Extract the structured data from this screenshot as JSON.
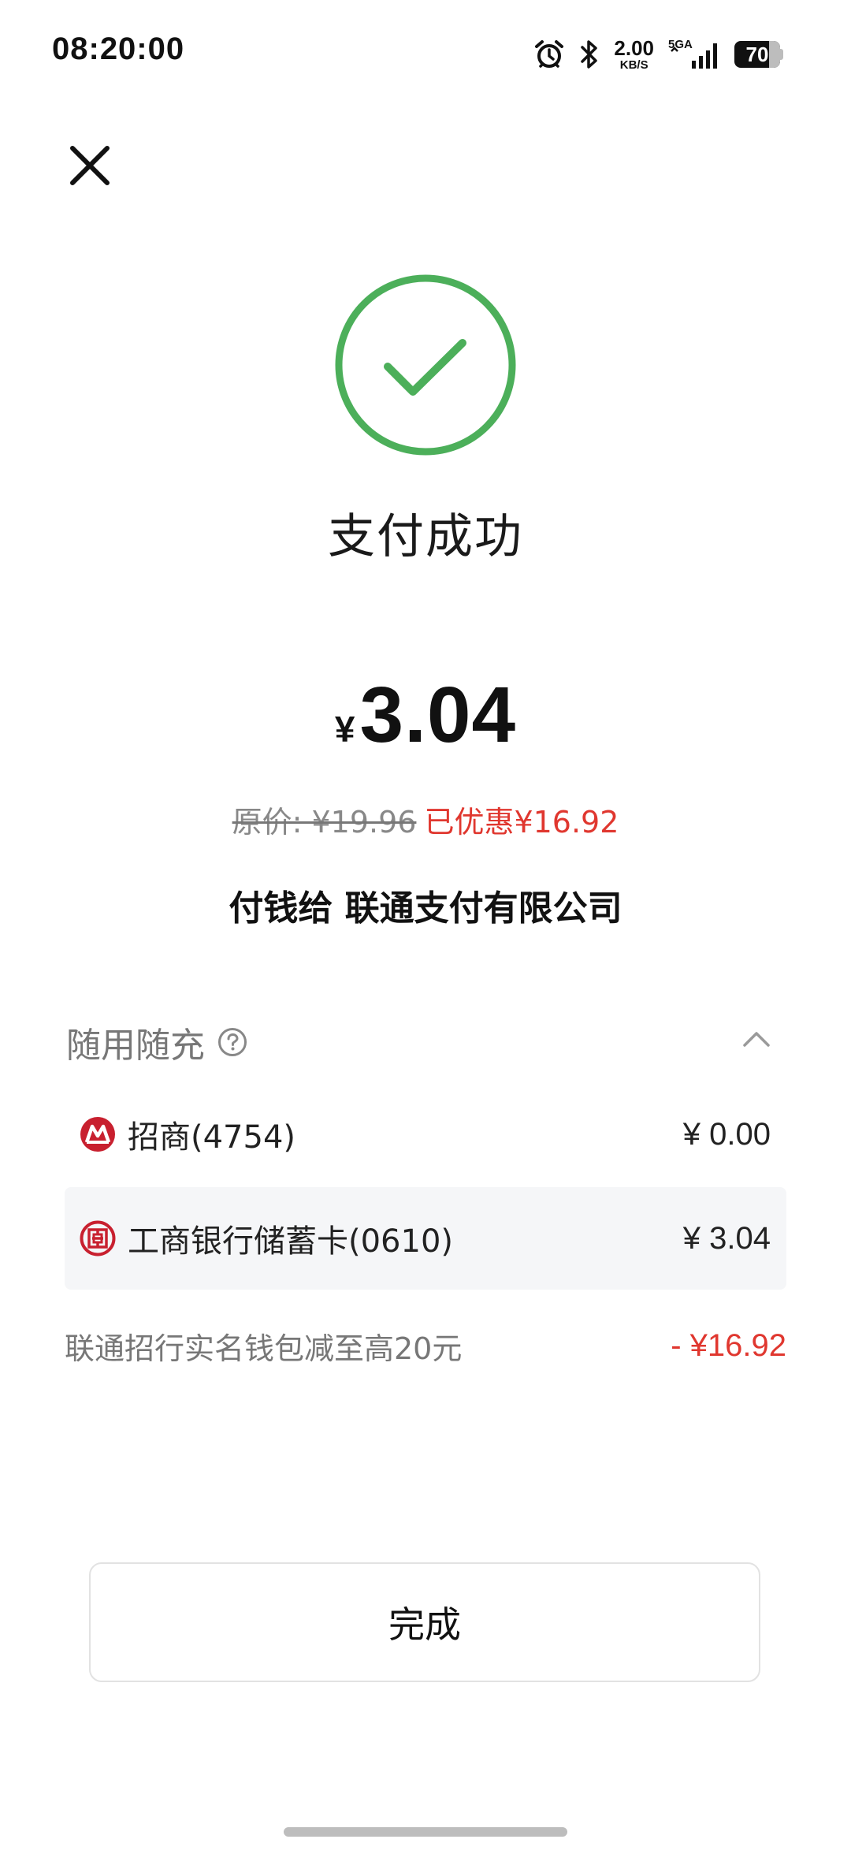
{
  "status_bar": {
    "time": "08:20:00",
    "net_speed_value": "2.00",
    "net_speed_unit": "KB/S",
    "signal_label": "5GA",
    "battery_level": "70",
    "icons": [
      "alarm-icon",
      "bluetooth-icon",
      "signal-icon",
      "battery-icon"
    ]
  },
  "header": {
    "close_icon": "close-icon"
  },
  "result": {
    "status_icon": "check-circle-icon",
    "title": "支付成功",
    "accent_color": "#4caf5a"
  },
  "payment": {
    "currency_symbol": "¥",
    "amount": "3.04",
    "original_price": "原价: ¥19.96",
    "discount": "已优惠¥16.92",
    "payee": "付钱给 联通支付有限公司"
  },
  "breakdown": {
    "section_title": "随用随充",
    "help_icon": "question-circle-icon",
    "collapse_icon": "chevron-up-icon",
    "methods": [
      {
        "icon": "cmb-bank-logo",
        "name": "招商(4754)",
        "amount": "¥ 0.00"
      },
      {
        "icon": "icbc-bank-logo",
        "name": "工商银行储蓄卡(0610)",
        "amount": "¥ 3.04"
      }
    ],
    "promotion": {
      "label": "联通招行实名钱包减至高20元",
      "value": "- ¥16.92"
    }
  },
  "actions": {
    "done_label": "完成"
  },
  "colors": {
    "success": "#4caf5a",
    "discount": "#e0372f",
    "muted_text": "#777777",
    "selected_row_bg": "#f5f6f8"
  }
}
